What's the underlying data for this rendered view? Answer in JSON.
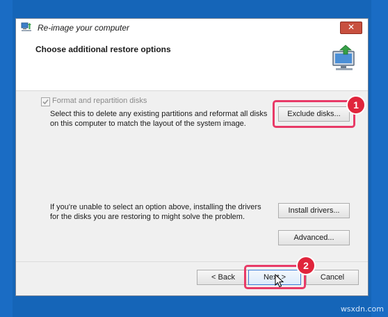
{
  "window": {
    "title": "Re-image your computer",
    "close_label": "✕"
  },
  "header": {
    "title": "Choose additional restore options"
  },
  "options": {
    "format_checkbox_label": "Format and repartition disks",
    "format_checked": true,
    "format_enabled": false,
    "format_description": "Select this to delete any existing partitions and reformat all disks on this computer to match the layout of the system image.",
    "drivers_description": "If you're unable to select an option above, installing the drivers for the disks you are restoring to might solve the problem."
  },
  "buttons": {
    "exclude_disks": "Exclude disks...",
    "install_drivers": "Install drivers...",
    "advanced": "Advanced...",
    "back": "< Back",
    "next": "Next >",
    "cancel": "Cancel"
  },
  "annotations": {
    "badge_1": "1",
    "badge_2": "2",
    "highlight_color": "#e83a67",
    "badge_color": "#e0253c"
  },
  "watermark": "wsxdn.com",
  "colors": {
    "desktop": "#1565b8",
    "window_bg": "#f0f0f0",
    "close_button": "#c8503f"
  }
}
